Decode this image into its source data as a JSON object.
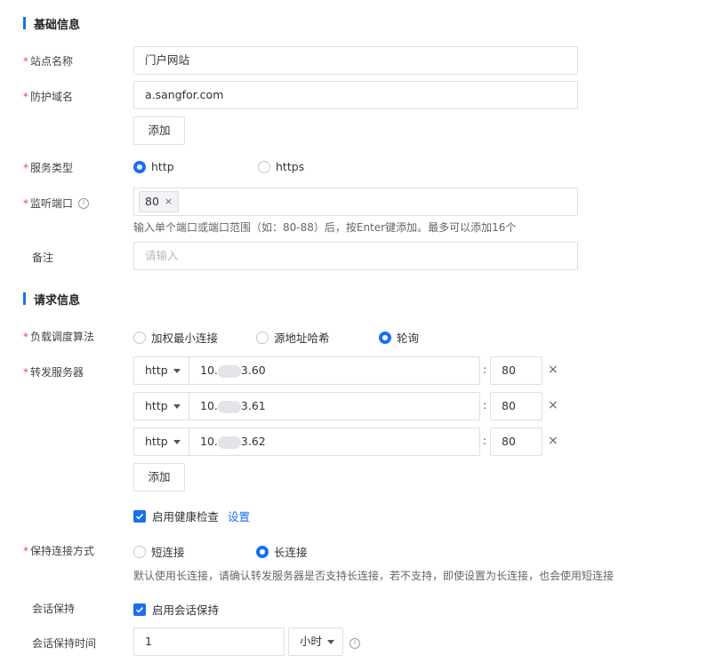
{
  "basic_section": {
    "title": "基础信息"
  },
  "site_name": {
    "label": "站点名称",
    "value": "门户网站"
  },
  "domain": {
    "label": "防护域名",
    "value": "a.sangfor.com",
    "add_label": "添加"
  },
  "service_type": {
    "label": "服务类型",
    "options": [
      "http",
      "https"
    ],
    "selected": "http"
  },
  "listen_port": {
    "label": "监听端口",
    "tags": [
      "80"
    ],
    "hint": "输入单个端口或端口范围（如：80-88）后，按Enter键添加。最多可以添加16个"
  },
  "remark": {
    "label": "备注",
    "placeholder": "请输入"
  },
  "request_section": {
    "title": "请求信息"
  },
  "lb_algorithm": {
    "label": "负载调度算法",
    "options": [
      "加权最小连接",
      "源地址哈希",
      "轮询"
    ],
    "selected": "轮询"
  },
  "forward_servers": {
    "label": "转发服务器",
    "rows": [
      {
        "protocol": "http",
        "ip_prefix": "10.",
        "ip_suffix": "3.60",
        "port": "80"
      },
      {
        "protocol": "http",
        "ip_prefix": "10.",
        "ip_suffix": "3.61",
        "port": "80"
      },
      {
        "protocol": "http",
        "ip_prefix": "10.",
        "ip_suffix": "3.62",
        "port": "80"
      }
    ],
    "separator": ":",
    "add_label": "添加",
    "health_check_label": "启用健康检查",
    "health_check_checked": true,
    "settings_link": "设置"
  },
  "keepalive": {
    "label": "保持连接方式",
    "options": [
      "短连接",
      "长连接"
    ],
    "selected": "长连接",
    "hint": "默认使用长连接，请确认转发服务器是否支持长连接，若不支持，即使设置为长连接，也会使用短连接"
  },
  "session": {
    "label": "会话保持",
    "checkbox_label": "启用会话保持",
    "checked": true
  },
  "session_time": {
    "label": "会话保持时间",
    "value": "1",
    "unit": "小时"
  },
  "colors": {
    "accent": "#1a6ff0",
    "required": "#e34d4d",
    "border": "#dcdfe6"
  }
}
